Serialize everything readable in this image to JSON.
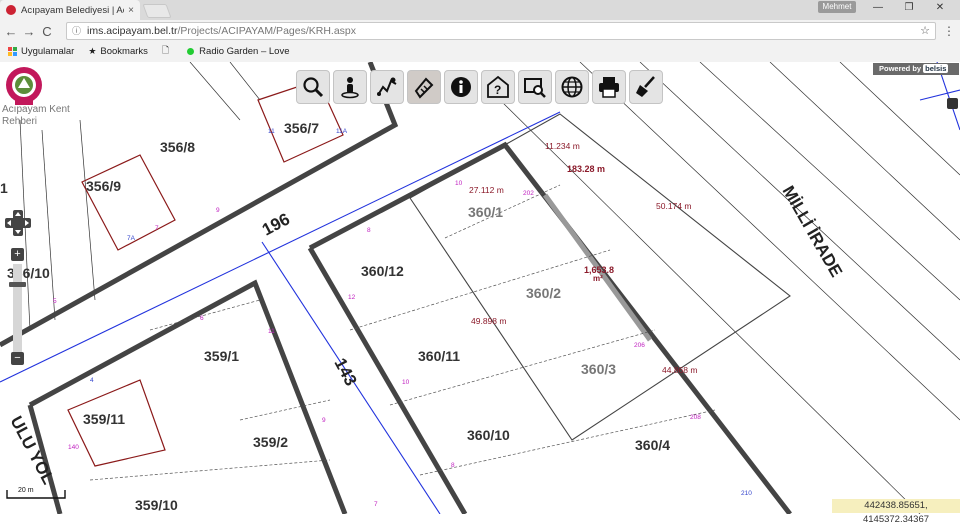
{
  "browser": {
    "tab_title": "Acıpayam Belediyesi | Ac",
    "tab_close": "×",
    "user_chip": "Mehmet",
    "win_min": "—",
    "win_restore": "❐",
    "win_close": "✕",
    "back": "←",
    "forward": "→",
    "reload": "C",
    "url_host": "ims.acipayam.bel.tr",
    "url_path": "/Projects/ACIPAYAM/Pages/KRH.aspx",
    "star": "☆",
    "menu": "⋮",
    "bookmarks": [
      {
        "label": "Uygulamalar"
      },
      {
        "label": "Bookmarks"
      },
      {
        "label": ""
      },
      {
        "label": "Radio Garden – Love"
      }
    ]
  },
  "app": {
    "logo_text_line1": "Acıpayam Kent",
    "logo_text_line2": "Rehberi",
    "powered_by": "Powered by",
    "powered_brand": "belsis",
    "zoom_in": "+",
    "zoom_out": "−",
    "scale_label": "20 m",
    "coordinates": "442438.85651, 4145372.34367",
    "tools": [
      {
        "name": "zoom-tool",
        "icon": "magnifier-icon",
        "active": false
      },
      {
        "name": "street-view-tool",
        "icon": "person-pin-icon",
        "active": false
      },
      {
        "name": "route-tool",
        "icon": "route-icon",
        "active": false
      },
      {
        "name": "measure-tool",
        "icon": "ruler-pencil-icon",
        "active": true
      },
      {
        "name": "info-tool",
        "icon": "info-icon",
        "active": false
      },
      {
        "name": "query-tool",
        "icon": "house-question-icon",
        "active": false
      },
      {
        "name": "select-tool",
        "icon": "select-zoom-icon",
        "active": false
      },
      {
        "name": "globe-tool",
        "icon": "globe-icon",
        "active": false
      },
      {
        "name": "print-tool",
        "icon": "printer-icon",
        "active": false
      },
      {
        "name": "clear-tool",
        "icon": "broom-icon",
        "active": false
      }
    ]
  },
  "map": {
    "streets": [
      {
        "label": "196"
      },
      {
        "label": "143"
      },
      {
        "label": "MİLLİ İRADE"
      },
      {
        "label": "ULU YOL"
      }
    ],
    "parcels": [
      {
        "label": "356/7"
      },
      {
        "label": "356/8"
      },
      {
        "label": "356/9"
      },
      {
        "label": "356/10"
      },
      {
        "label": "360/1"
      },
      {
        "label": "360/2"
      },
      {
        "label": "360/3"
      },
      {
        "label": "360/4"
      },
      {
        "label": "360/10"
      },
      {
        "label": "360/11"
      },
      {
        "label": "360/12"
      },
      {
        "label": "359/1"
      },
      {
        "label": "359/2"
      },
      {
        "label": "359/10"
      },
      {
        "label": "359/11"
      },
      {
        "label": "1"
      }
    ],
    "measurements": [
      {
        "label": "11.234 m"
      },
      {
        "label": "183.28 m"
      },
      {
        "label": "27.112 m"
      },
      {
        "label": "50.174 m"
      },
      {
        "label": "1,653.8"
      },
      {
        "label": "m²"
      },
      {
        "label": "49.898 m"
      },
      {
        "label": "44.868 m"
      }
    ],
    "door_numbers": [
      {
        "label": "11"
      },
      {
        "label": "11A"
      },
      {
        "label": "10"
      },
      {
        "label": "202"
      },
      {
        "label": "9"
      },
      {
        "label": "7"
      },
      {
        "label": "7A"
      },
      {
        "label": "8"
      },
      {
        "label": "12"
      },
      {
        "label": "6"
      },
      {
        "label": "11"
      },
      {
        "label": "5"
      },
      {
        "label": "4"
      },
      {
        "label": "10"
      },
      {
        "label": "9"
      },
      {
        "label": "8"
      },
      {
        "label": "206"
      },
      {
        "label": "208"
      },
      {
        "label": "210"
      },
      {
        "label": "140"
      },
      {
        "label": "7"
      }
    ]
  }
}
